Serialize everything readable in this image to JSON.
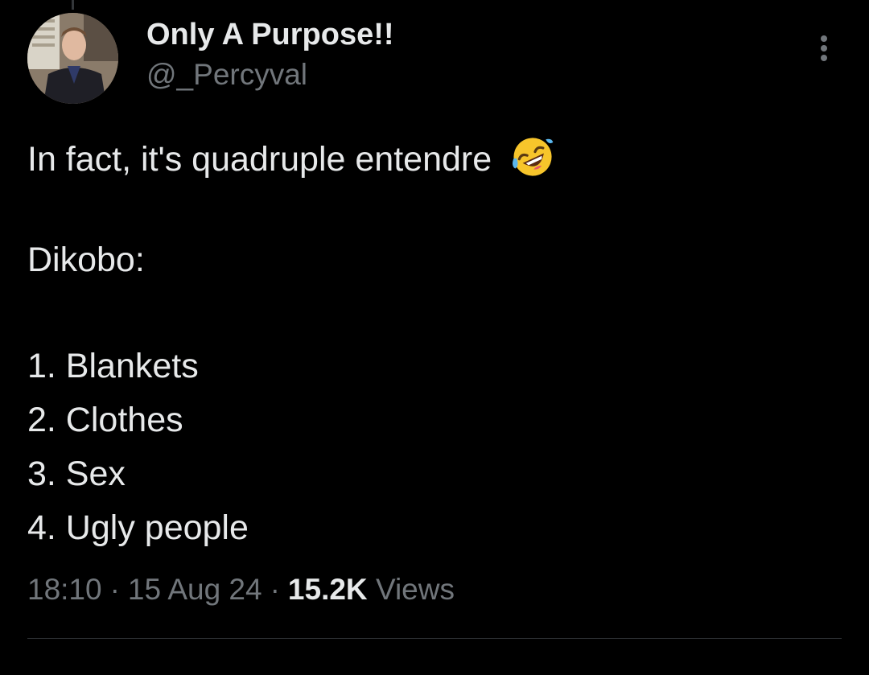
{
  "user": {
    "display_name": "Only A Purpose!!",
    "handle": "@_Percyval"
  },
  "tweet": {
    "line1": "In fact, it's quadruple entendre",
    "emoji": "rolling-on-floor-laughing-emoji",
    "line2": "Dikobo:",
    "list": [
      "1. Blankets",
      "2. Clothes",
      "3. Sex",
      "4. Ugly people"
    ]
  },
  "meta": {
    "time": "18:10",
    "separator": "·",
    "date": "15 Aug 24",
    "views_count": "15.2K",
    "views_label": "Views"
  },
  "icons": {
    "more": "more-options-icon"
  },
  "colors": {
    "background": "#000000",
    "primary_text": "#e7e9ea",
    "secondary_text": "#71767b",
    "divider": "#2f3336"
  }
}
